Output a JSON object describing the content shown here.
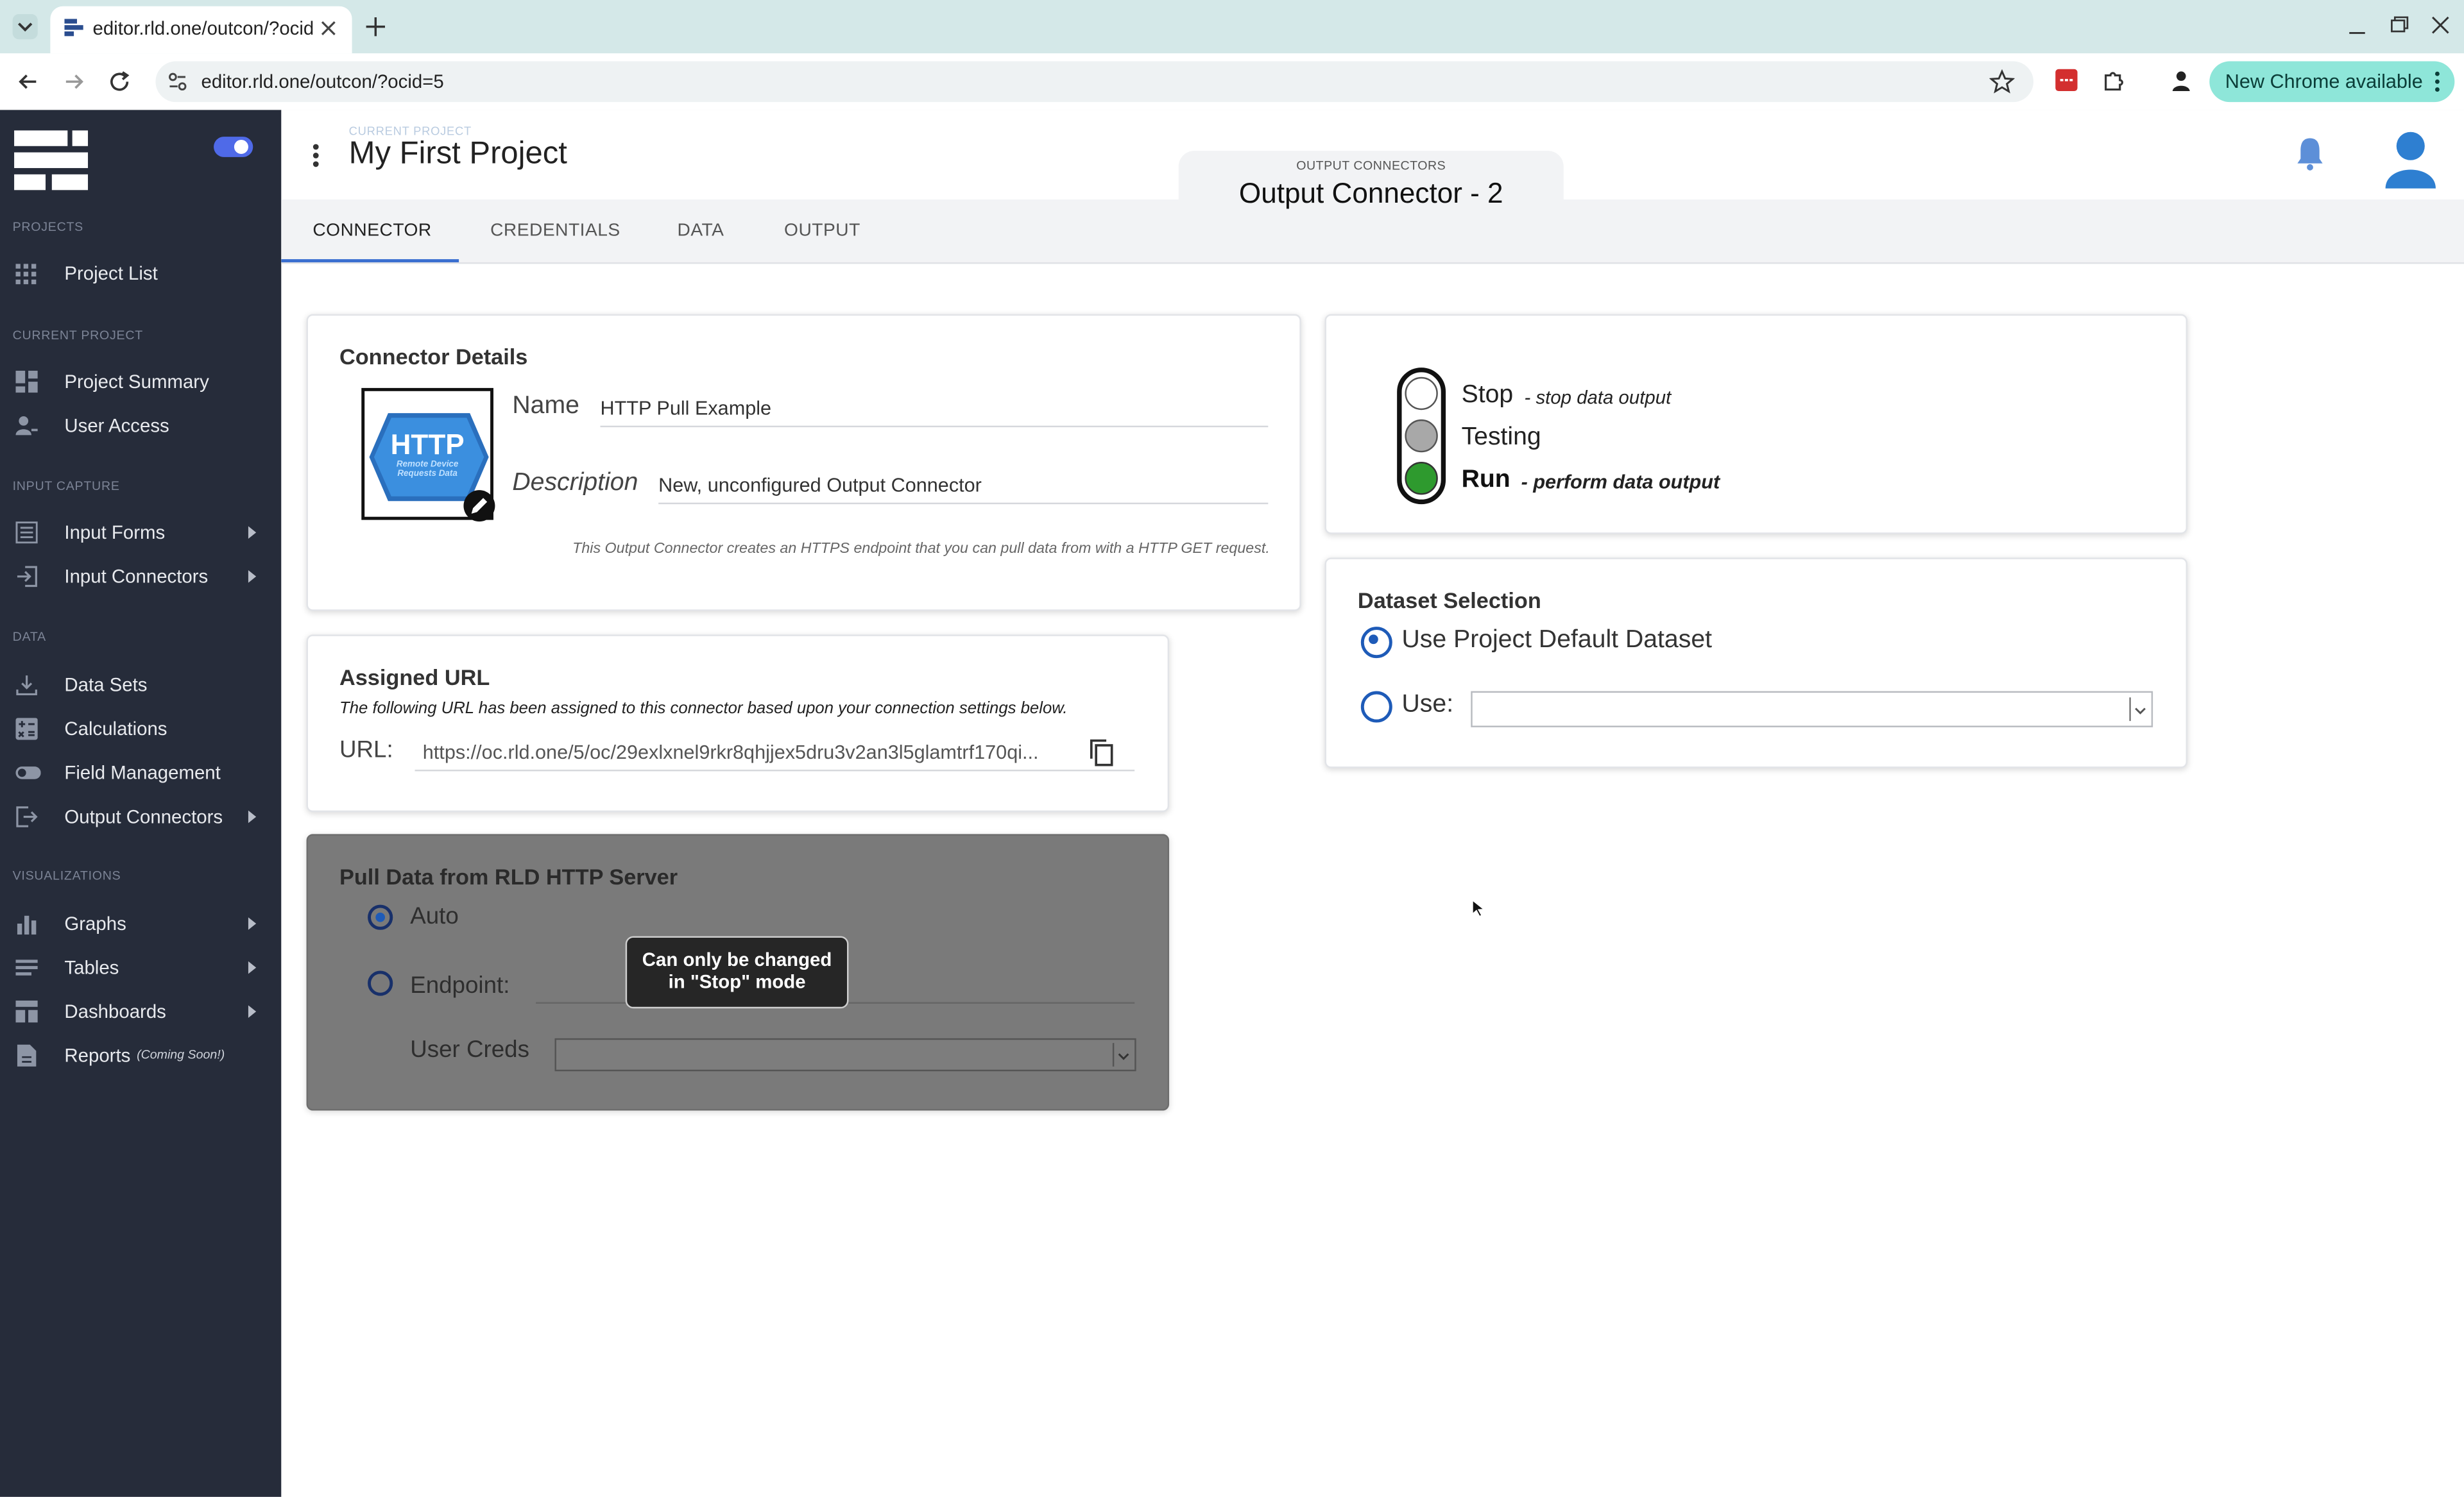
{
  "browser": {
    "tab_title": "editor.rld.one/outcon/?ocid",
    "url": "editor.rld.one/outcon/?ocid=5",
    "new_chrome_label": "New Chrome available"
  },
  "sidebar": {
    "sections": {
      "projects": "PROJECTS",
      "current_project": "CURRENT PROJECT",
      "input_capture": "INPUT CAPTURE",
      "data": "DATA",
      "visualizations": "VISUALIZATIONS"
    },
    "items": {
      "project_list": "Project List",
      "project_summary": "Project Summary",
      "user_access": "User Access",
      "input_forms": "Input Forms",
      "input_connectors": "Input Connectors",
      "data_sets": "Data Sets",
      "calculations": "Calculations",
      "field_management": "Field Management",
      "output_connectors": "Output Connectors",
      "graphs": "Graphs",
      "tables": "Tables",
      "dashboards": "Dashboards",
      "reports": "Reports",
      "reports_note": "(Coming Soon!)"
    }
  },
  "header": {
    "current_project_caption": "CURRENT PROJECT",
    "project_name": "My First Project",
    "section_caption": "OUTPUT CONNECTORS",
    "connector_title": "Output Connector - 2"
  },
  "tabs": [
    "CONNECTOR",
    "CREDENTIALS",
    "DATA",
    "OUTPUT"
  ],
  "connector_details": {
    "heading": "Connector Details",
    "logo_text": "HTTP",
    "logo_subtext": "Remote Device Requests Data",
    "name_label": "Name",
    "name_value": "HTTP Pull Example",
    "description_label": "Description",
    "description_value": "New, unconfigured Output Connector",
    "info": "This Output Connector creates an HTTPS endpoint that you can pull data from with a HTTP GET request."
  },
  "assigned_url": {
    "heading": "Assigned URL",
    "note": "The following URL has been assigned to this connector based upon your connection settings below.",
    "label": "URL:",
    "value": "https://oc.rld.one/5/oc/29exlxnel9rkr8qhjjex5dru3v2an3l5glamtrf170qi..."
  },
  "pull_data": {
    "heading": "Pull Data from RLD HTTP Server",
    "auto_label": "Auto",
    "endpoint_label": "Endpoint:",
    "user_creds_label": "User Creds",
    "tooltip": "Can only be changed in \"Stop\" mode"
  },
  "status": {
    "stop_label": "Stop",
    "stop_desc": "- stop data output",
    "testing_label": "Testing",
    "run_label": "Run",
    "run_desc": "- perform data output",
    "active": "run",
    "colors": {
      "off": "#ffffff",
      "testing": "#a8a8a8",
      "run": "#2e9a2e"
    }
  },
  "dataset_selection": {
    "heading": "Dataset Selection",
    "default_label": "Use Project Default Dataset",
    "use_label": "Use:"
  }
}
